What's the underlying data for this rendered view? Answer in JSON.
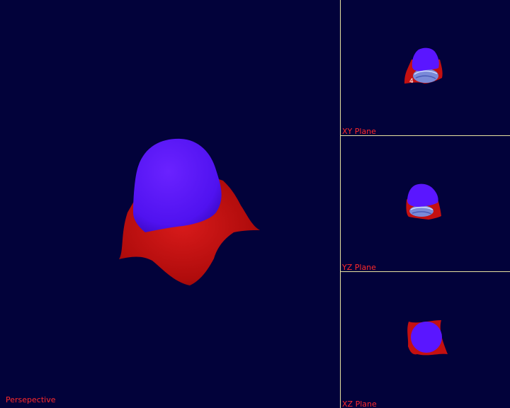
{
  "viewports": {
    "perspective": {
      "label": "Persepective"
    },
    "xy": {
      "label": "XY Plane",
      "marker": "4"
    },
    "yz": {
      "label": "YZ Plane"
    },
    "xz": {
      "label": "XZ Plane"
    }
  },
  "colors": {
    "background": "#02023a",
    "divider": "#e8e2a0",
    "label": "#ff2a2a",
    "surface_top": "#5a16ff",
    "surface_skirt": "#c41010"
  }
}
